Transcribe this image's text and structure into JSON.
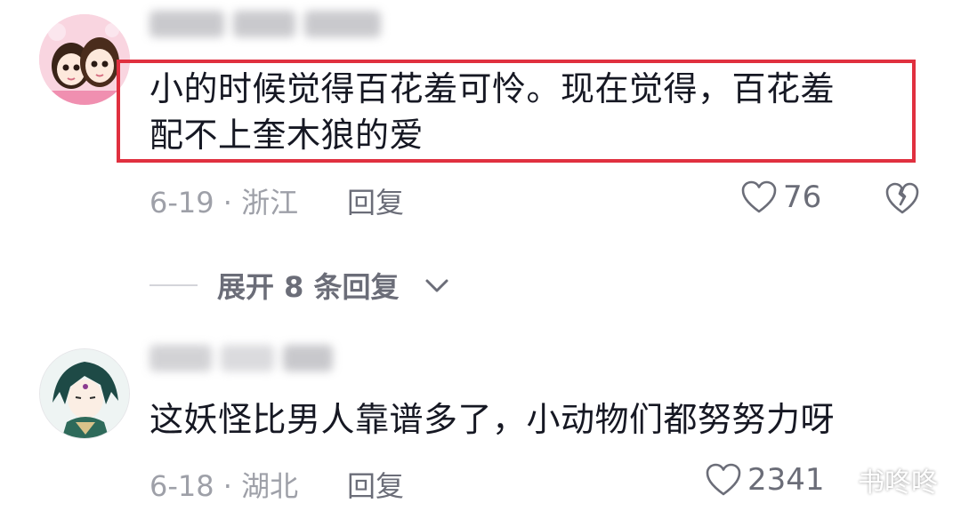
{
  "comments": [
    {
      "text_line1": "小的时候觉得百花羞可怜。现在觉得，百花羞",
      "text_line2": "配不上奎木狼的爱",
      "date": "6-19",
      "location": "浙江",
      "reply_label": "回复",
      "likes": "76"
    },
    {
      "text_line1": "这妖怪比男人靠谱多了，小动物们都努努力呀",
      "date": "6-18",
      "location": "湖北",
      "reply_label": "回复",
      "likes": "2341"
    }
  ],
  "expand_replies": {
    "label": "展开 8 条回复"
  },
  "watermark": {
    "text": "书咚咚"
  },
  "colors": {
    "highlight_border": "#e0303f",
    "meta_text": "#9ea0a8",
    "secondary_text": "#6b6d78"
  }
}
